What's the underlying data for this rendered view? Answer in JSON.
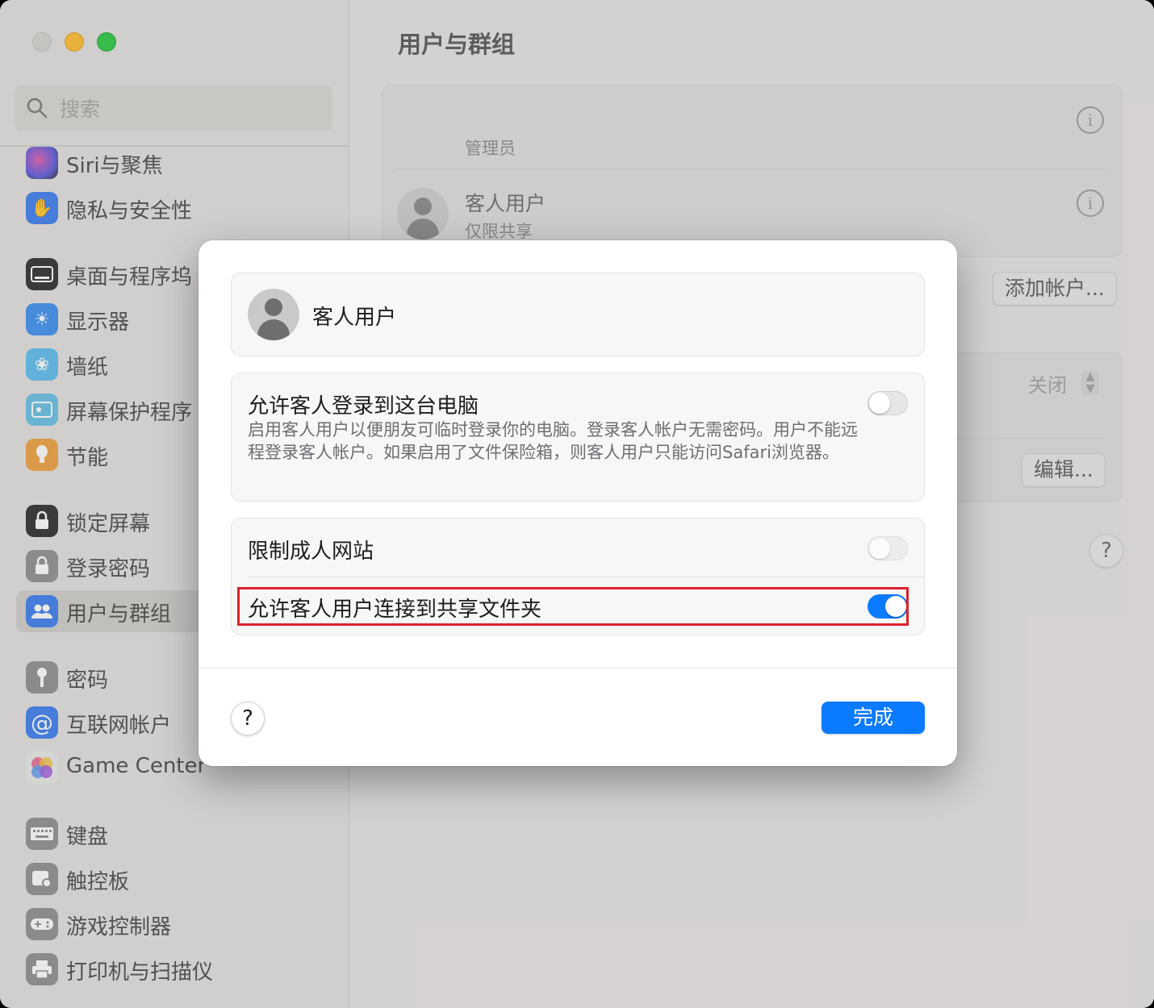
{
  "sidebar": {
    "search_placeholder": "搜索",
    "items": [
      {
        "label": "Siri与聚焦",
        "icon": "siri-icon",
        "color": "#7d6dd9"
      },
      {
        "label": "隐私与安全性",
        "icon": "hand-icon",
        "color": "#3b7cf0"
      },
      {
        "label": "桌面与程序坞",
        "icon": "dock-icon",
        "color": "#2b2b2b"
      },
      {
        "label": "显示器",
        "icon": "sun-icon",
        "color": "#3b8ff0"
      },
      {
        "label": "墙纸",
        "icon": "flower-icon",
        "color": "#5bbcf0"
      },
      {
        "label": "屏幕保护程序",
        "icon": "screensaver-icon",
        "color": "#66c0e6"
      },
      {
        "label": "节能",
        "icon": "bulb-icon",
        "color": "#f0a040"
      },
      {
        "label": "锁定屏幕",
        "icon": "lock-screen-icon",
        "color": "#2b2b2b"
      },
      {
        "label": "登录密码",
        "icon": "lock-icon",
        "color": "#8e8e8e"
      },
      {
        "label": "用户与群组",
        "icon": "users-icon",
        "color": "#3b7cf0"
      },
      {
        "label": "密码",
        "icon": "key-icon",
        "color": "#8e8e8e"
      },
      {
        "label": "互联网帐户",
        "icon": "at-icon",
        "color": "#3b7cf0"
      },
      {
        "label": "Game Center",
        "icon": "game-center-icon",
        "color": "#e8e8e8"
      },
      {
        "label": "键盘",
        "icon": "keyboard-icon",
        "color": "#8e8e8e"
      },
      {
        "label": "触控板",
        "icon": "trackpad-icon",
        "color": "#8e8e8e"
      },
      {
        "label": "游戏控制器",
        "icon": "gamepad-icon",
        "color": "#8e8e8e"
      },
      {
        "label": "打印机与扫描仪",
        "icon": "printer-icon",
        "color": "#8e8e8e"
      }
    ]
  },
  "main": {
    "title": "用户与群组",
    "admin_label": "管理员",
    "guest_name": "客人用户",
    "guest_sub": "仅限共享",
    "add_account_label": "添加帐户...",
    "auto_login_value": "关闭",
    "edit_label": "编辑...",
    "help_label": "?"
  },
  "dialog": {
    "user_name": "客人用户",
    "allow_login_title": "允许客人登录到这台电脑",
    "allow_login_desc": "启用客人用户以便朋友可临时登录你的电脑。登录客人帐户无需密码。用户不能远程登录客人帐户。如果启用了文件保险箱，则客人用户只能访问Safari浏览器。",
    "allow_login_on": false,
    "limit_adult_title": "限制成人网站",
    "limit_adult_on": false,
    "shared_folders_title": "允许客人用户连接到共享文件夹",
    "shared_folders_on": true,
    "help_label": "?",
    "done_label": "完成"
  },
  "colors": {
    "accent": "#0a7aff",
    "highlight_border": "#e0202a"
  }
}
